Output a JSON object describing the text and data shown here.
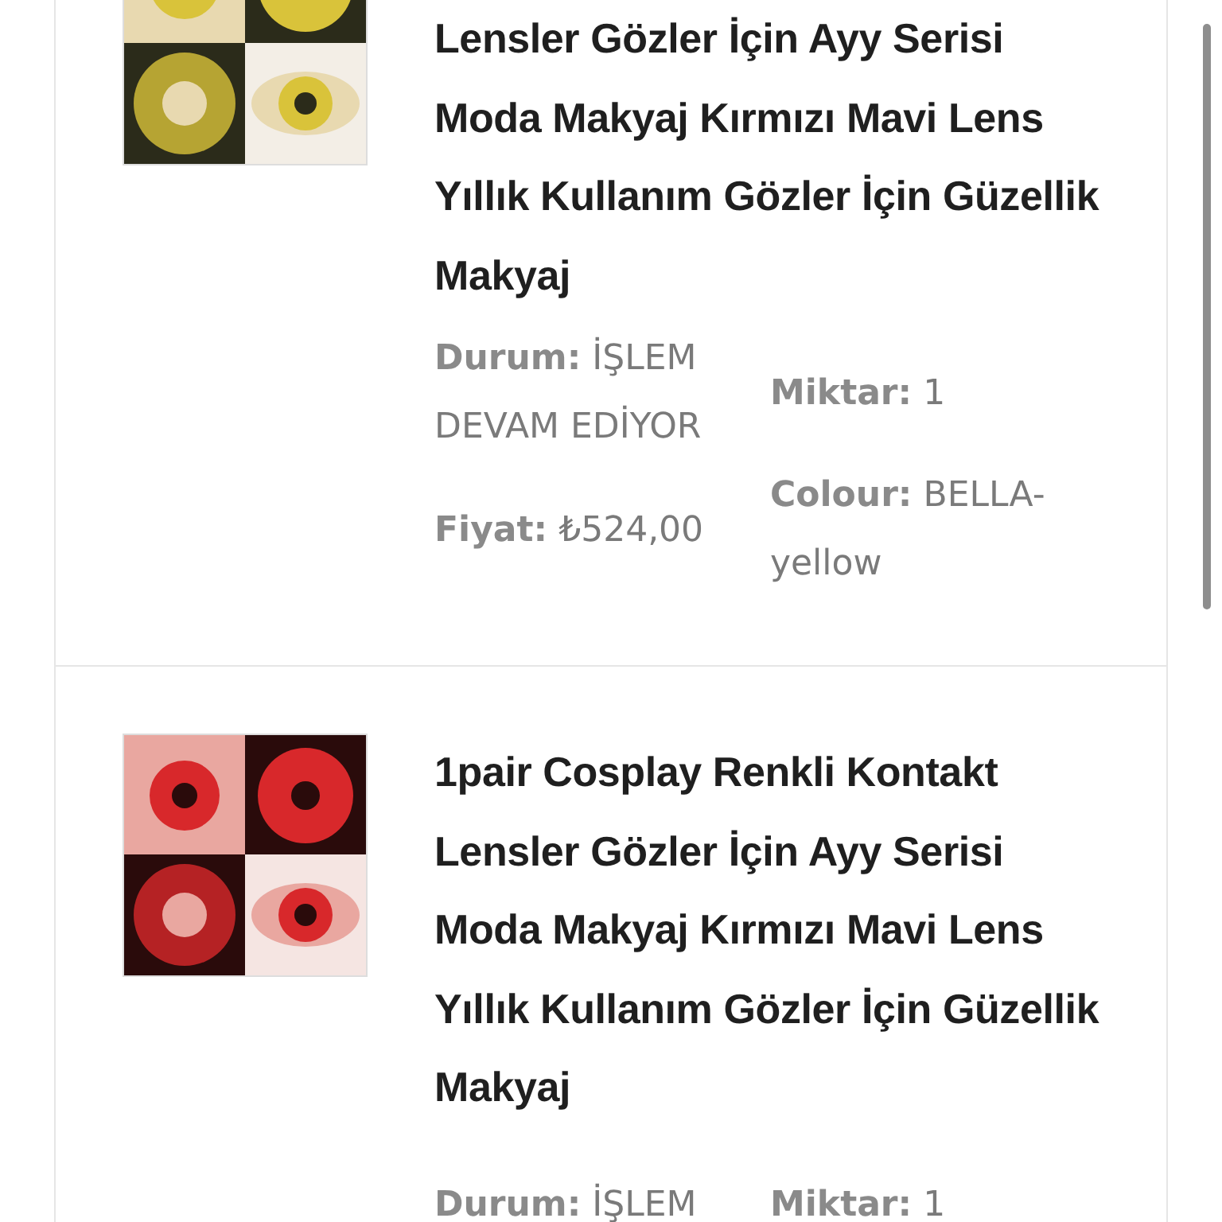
{
  "orders": [
    {
      "title": "Lensler Gözler İçin Ayy Serisi Moda Makyaj Kırmızı Mavi Lens Yıllık Kullanım Gözler İçin Güzellik Makyaj",
      "status_label": "Durum:",
      "status": "İŞLEM DEVAM EDİYOR",
      "quantity_label": "Miktar:",
      "quantity": "1",
      "price_label": "Fiyat:",
      "price": "₺524,00",
      "colour_label": "Colour:",
      "colour": "BELLA-yellow"
    },
    {
      "title": "1pair Cosplay Renkli Kontakt Lensler Gözler İçin Ayy Serisi Moda Makyaj Kırmızı Mavi Lens Yıllık Kullanım Gözler İçin Güzellik Makyaj",
      "status_label": "Durum:",
      "status": "İŞLEM",
      "quantity_label": "Miktar:",
      "quantity": "1"
    }
  ]
}
